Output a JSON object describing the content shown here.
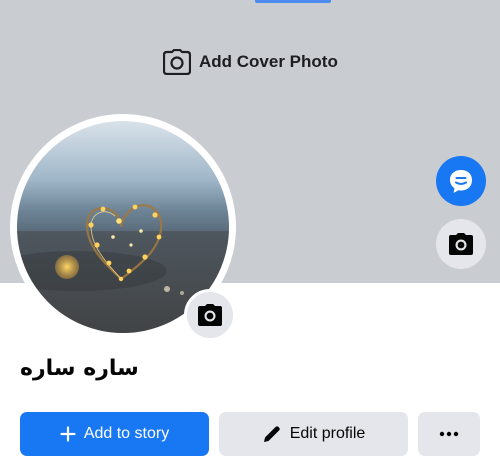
{
  "cover": {
    "add_cover_label": "Add Cover Photo"
  },
  "profile": {
    "name": "ساره ساره"
  },
  "actions": {
    "add_story_label": "Add to story",
    "edit_profile_label": "Edit profile"
  },
  "icons": {
    "cover": "camera-icon",
    "avatar_camera": "camera-icon",
    "side_camera": "camera-icon",
    "messenger": "chat-bubble-icon",
    "add": "plus-icon",
    "edit": "pencil-icon",
    "more": "more-dots-icon"
  },
  "colors": {
    "cover_bg": "#c9ccd1",
    "accent": "#1877f2",
    "secondary_button": "#e4e6eb",
    "text": "#050505"
  }
}
